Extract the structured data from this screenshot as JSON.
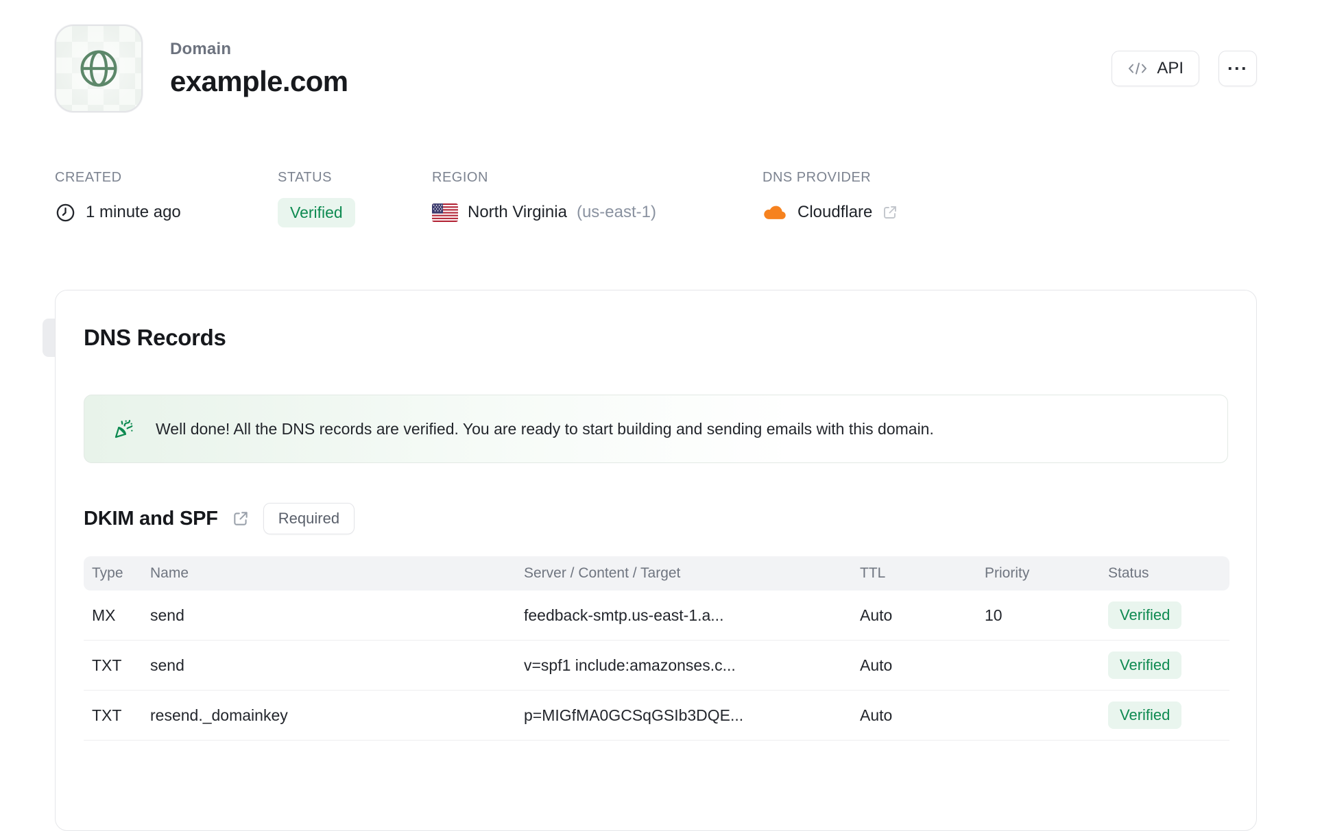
{
  "header": {
    "label": "Domain",
    "title": "example.com",
    "api_button_label": "API",
    "menu_button_label": "···",
    "icons": [
      "globe-icon",
      "code-icon",
      "ellipsis-icon"
    ]
  },
  "meta": {
    "created": {
      "label": "CREATED",
      "value": "1 minute ago",
      "icon": "clock-icon"
    },
    "status": {
      "label": "STATUS",
      "value": "Verified"
    },
    "region": {
      "label": "REGION",
      "value": "North Virginia",
      "code": "(us-east-1)",
      "icon": "us-flag-icon"
    },
    "dns_provider": {
      "label": "DNS PROVIDER",
      "value": "Cloudflare",
      "icons": [
        "cloudflare-icon",
        "external-link-icon"
      ]
    }
  },
  "dns_card": {
    "title": "DNS Records",
    "success_message": "Well done! All the DNS records are verified. You are ready to start building and sending emails with this domain.",
    "success_icon": "party-popper-icon",
    "section": {
      "title": "DKIM and SPF",
      "icon": "external-link-icon",
      "badge": "Required"
    },
    "table": {
      "headers": [
        "Type",
        "Name",
        "Server / Content / Target",
        "TTL",
        "Priority",
        "Status"
      ],
      "rows": [
        {
          "type": "MX",
          "name": "send",
          "content": "feedback-smtp.us-east-1.a...",
          "ttl": "Auto",
          "priority": "10",
          "status": "Verified"
        },
        {
          "type": "TXT",
          "name": "send",
          "content": "v=spf1 include:amazonses.c...",
          "ttl": "Auto",
          "priority": "",
          "status": "Verified"
        },
        {
          "type": "TXT",
          "name": "resend._domainkey",
          "content": "p=MIGfMA0GCSqGSIb3DQE...",
          "ttl": "Auto",
          "priority": "",
          "status": "Verified"
        }
      ]
    }
  },
  "colors": {
    "accent_green": "#0e8a51",
    "green_badge_bg": "#e9f5ee",
    "globe_green": "#5c8769",
    "cloudflare_orange": "#f6821f",
    "card_border": "#e5e6e9"
  }
}
